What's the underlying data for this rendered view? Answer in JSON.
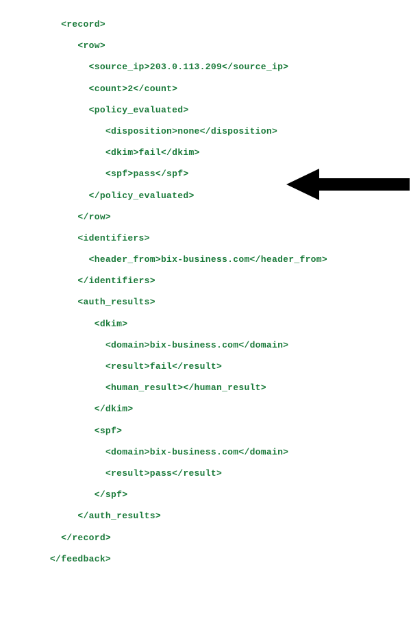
{
  "xml": {
    "record_open": "<record>",
    "row_open": "<row>",
    "source_ip": "<source_ip>203.0.113.209</source_ip>",
    "count": "<count>2</count>",
    "policy_evaluated_open": "<policy_evaluated>",
    "disposition": "<disposition>none</disposition>",
    "dkim_policy": "<dkim>fail</dkim>",
    "spf_policy": "<spf>pass</spf>",
    "policy_evaluated_close": "</policy_evaluated>",
    "row_close": "</row>",
    "identifiers_open": "<identifiers>",
    "header_from": "<header_from>bix-business.com</header_from>",
    "identifiers_close": "</identifiers>",
    "auth_results_open": "<auth_results>",
    "dkim_open": "<dkim>",
    "dkim_domain": "<domain>bix-business.com</domain>",
    "dkim_result": "<result>fail</result>",
    "dkim_human_result": "<human_result></human_result>",
    "dkim_close": "</dkim>",
    "spf_open": "<spf>",
    "spf_domain": "<domain>bix-business.com</domain>",
    "spf_result": "<result>pass</result>",
    "spf_close": "</spf>",
    "auth_results_close": "</auth_results>",
    "record_close": "</record>",
    "feedback_close": "</feedback>"
  },
  "indent": {
    "l0": "         ",
    "l1": "           ",
    "l2": "              ",
    "l3": "                ",
    "l4": "                   ",
    "l3b": "                 "
  }
}
